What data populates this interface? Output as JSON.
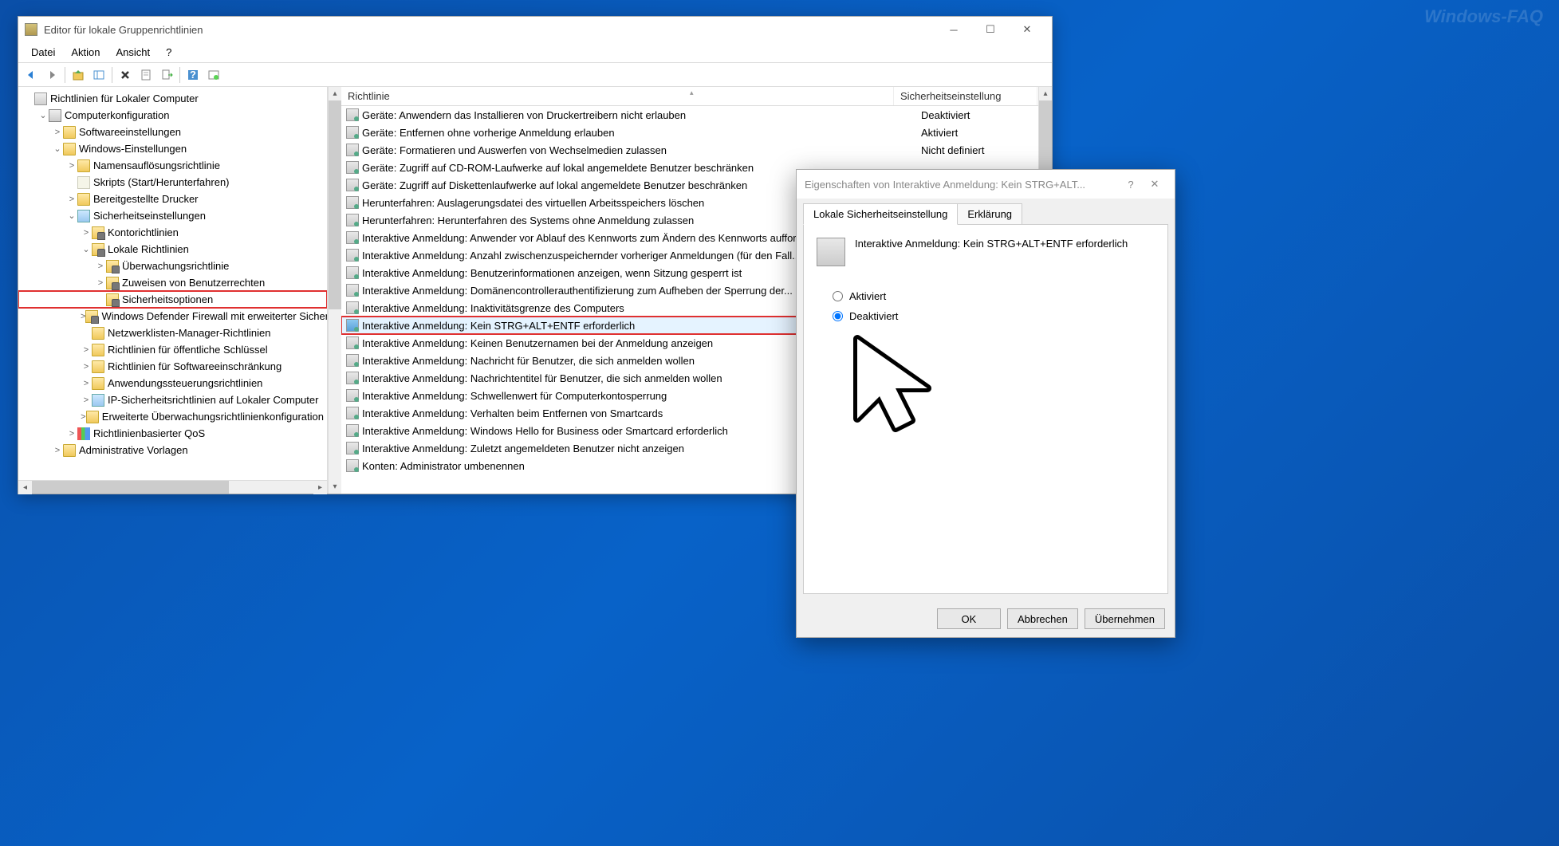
{
  "watermark": "Windows-FAQ",
  "window": {
    "title": "Editor für lokale Gruppenrichtlinien",
    "menu": [
      "Datei",
      "Aktion",
      "Ansicht",
      "?"
    ]
  },
  "tree": {
    "root": "Richtlinien für Lokaler Computer",
    "nodes": [
      {
        "indent": 0,
        "tw": "",
        "icon": "gpo",
        "label": "Richtlinien für Lokaler Computer"
      },
      {
        "indent": 1,
        "tw": "⌄",
        "icon": "computer",
        "label": "Computerkonfiguration"
      },
      {
        "indent": 2,
        "tw": ">",
        "icon": "folder",
        "label": "Softwareeinstellungen"
      },
      {
        "indent": 2,
        "tw": "⌄",
        "icon": "folder",
        "label": "Windows-Einstellungen"
      },
      {
        "indent": 3,
        "tw": ">",
        "icon": "folder",
        "label": "Namensauflösungsrichtlinie"
      },
      {
        "indent": 3,
        "tw": "",
        "icon": "scroll",
        "label": "Skripts (Start/Herunterfahren)"
      },
      {
        "indent": 3,
        "tw": ">",
        "icon": "folder",
        "label": "Bereitgestellte Drucker"
      },
      {
        "indent": 3,
        "tw": "⌄",
        "icon": "sec",
        "label": "Sicherheitseinstellungen"
      },
      {
        "indent": 4,
        "tw": ">",
        "icon": "folder-lock",
        "label": "Kontorichtlinien"
      },
      {
        "indent": 4,
        "tw": "⌄",
        "icon": "folder-lock",
        "label": "Lokale Richtlinien"
      },
      {
        "indent": 5,
        "tw": ">",
        "icon": "folder-lock",
        "label": "Überwachungsrichtlinie"
      },
      {
        "indent": 5,
        "tw": ">",
        "icon": "folder-lock",
        "label": "Zuweisen von Benutzerrechten"
      },
      {
        "indent": 5,
        "tw": "",
        "icon": "folder-lock",
        "label": "Sicherheitsoptionen",
        "sel": true
      },
      {
        "indent": 4,
        "tw": ">",
        "icon": "folder-lock",
        "label": "Windows Defender Firewall mit erweiterter Sicherheit"
      },
      {
        "indent": 4,
        "tw": "",
        "icon": "folder",
        "label": "Netzwerklisten-Manager-Richtlinien"
      },
      {
        "indent": 4,
        "tw": ">",
        "icon": "folder",
        "label": "Richtlinien für öffentliche Schlüssel"
      },
      {
        "indent": 4,
        "tw": ">",
        "icon": "folder",
        "label": "Richtlinien für Softwareeinschränkung"
      },
      {
        "indent": 4,
        "tw": ">",
        "icon": "folder",
        "label": "Anwendungssteuerungsrichtlinien"
      },
      {
        "indent": 4,
        "tw": ">",
        "icon": "sec",
        "label": "IP-Sicherheitsrichtlinien auf Lokaler Computer"
      },
      {
        "indent": 4,
        "tw": ">",
        "icon": "folder",
        "label": "Erweiterte Überwachungsrichtlinienkonfiguration"
      },
      {
        "indent": 3,
        "tw": ">",
        "icon": "bars",
        "label": "Richtlinienbasierter QoS"
      },
      {
        "indent": 2,
        "tw": ">",
        "icon": "folder",
        "label": "Administrative Vorlagen"
      }
    ]
  },
  "list": {
    "columns": [
      "Richtlinie",
      "Sicherheitseinstellung"
    ],
    "rows": [
      {
        "name": "Geräte: Anwendern das Installieren von Druckertreibern nicht erlauben",
        "value": "Deaktiviert"
      },
      {
        "name": "Geräte: Entfernen ohne vorherige Anmeldung erlauben",
        "value": "Aktiviert"
      },
      {
        "name": "Geräte: Formatieren und Auswerfen von Wechselmedien zulassen",
        "value": "Nicht definiert"
      },
      {
        "name": "Geräte: Zugriff auf CD-ROM-Laufwerke auf lokal angemeldete Benutzer beschränken",
        "value": ""
      },
      {
        "name": "Geräte: Zugriff auf Diskettenlaufwerke auf lokal angemeldete Benutzer beschränken",
        "value": ""
      },
      {
        "name": "Herunterfahren: Auslagerungsdatei des virtuellen Arbeitsspeichers löschen",
        "value": ""
      },
      {
        "name": "Herunterfahren: Herunterfahren des Systems ohne Anmeldung zulassen",
        "value": ""
      },
      {
        "name": "Interaktive Anmeldung: Anwender vor Ablauf des Kennworts zum Ändern des Kennworts auffordern",
        "value": ""
      },
      {
        "name": "Interaktive Anmeldung: Anzahl zwischenzuspeichernder vorheriger Anmeldungen (für den Fall...",
        "value": ""
      },
      {
        "name": "Interaktive Anmeldung: Benutzerinformationen anzeigen, wenn Sitzung gesperrt ist",
        "value": ""
      },
      {
        "name": "Interaktive Anmeldung: Domänencontrollerauthentifizierung zum Aufheben der Sperrung der...",
        "value": ""
      },
      {
        "name": "Interaktive Anmeldung: Inaktivitätsgrenze des Computers",
        "value": ""
      },
      {
        "name": "Interaktive Anmeldung: Kein STRG+ALT+ENTF erforderlich",
        "value": "",
        "hl": true
      },
      {
        "name": "Interaktive Anmeldung: Keinen Benutzernamen bei der Anmeldung anzeigen",
        "value": ""
      },
      {
        "name": "Interaktive Anmeldung: Nachricht für Benutzer, die sich anmelden wollen",
        "value": ""
      },
      {
        "name": "Interaktive Anmeldung: Nachrichtentitel für Benutzer, die sich anmelden wollen",
        "value": ""
      },
      {
        "name": "Interaktive Anmeldung: Schwellenwert für Computerkontosperrung",
        "value": ""
      },
      {
        "name": "Interaktive Anmeldung: Verhalten beim Entfernen von Smartcards",
        "value": ""
      },
      {
        "name": "Interaktive Anmeldung: Windows Hello for Business oder Smartcard erforderlich",
        "value": ""
      },
      {
        "name": "Interaktive Anmeldung: Zuletzt angemeldeten Benutzer nicht anzeigen",
        "value": ""
      },
      {
        "name": "Konten: Administrator umbenennen",
        "value": ""
      }
    ]
  },
  "dialog": {
    "title": "Eigenschaften von Interaktive Anmeldung: Kein STRG+ALT...",
    "tabs": [
      "Lokale Sicherheitseinstellung",
      "Erklärung"
    ],
    "policy_name": "Interaktive Anmeldung: Kein STRG+ALT+ENTF erforderlich",
    "option_enabled": "Aktiviert",
    "option_disabled": "Deaktiviert",
    "selected": "disabled",
    "buttons": {
      "ok": "OK",
      "cancel": "Abbrechen",
      "apply": "Übernehmen"
    }
  }
}
